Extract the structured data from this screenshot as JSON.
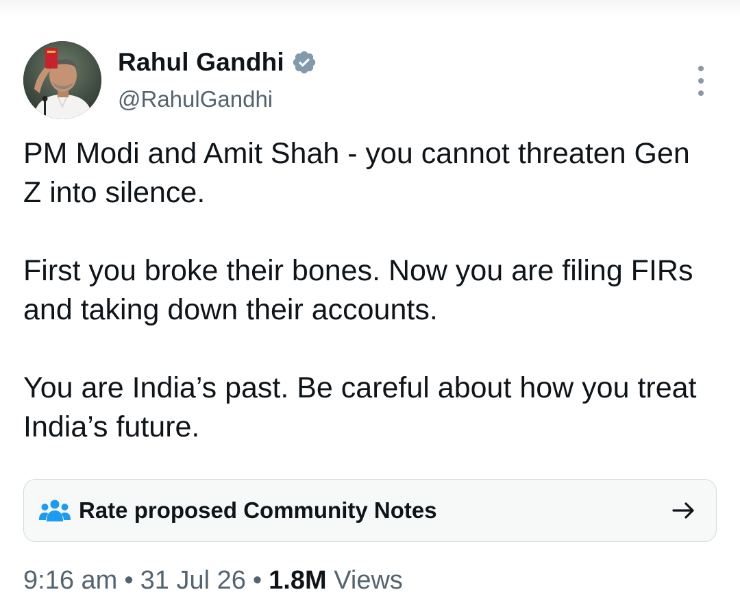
{
  "author": {
    "display_name": "Rahul Gandhi",
    "handle": "@RahulGandhi",
    "verified": true,
    "verified_icon": "verified-badge-icon"
  },
  "tweet": {
    "paragraphs": [
      "PM Modi and Amit Shah - you cannot threaten Gen Z into silence.",
      "First you broke their bones. Now you are filing FIRs and taking down their accounts.",
      "You are India’s past. Be careful about how you treat India’s future."
    ]
  },
  "community_notes": {
    "label": "Rate proposed Community Notes",
    "icon": "people-icon",
    "arrow_icon": "arrow-right-icon"
  },
  "meta": {
    "time": "9:16 am",
    "date": "31 Jul 26",
    "views_count": "1.8M",
    "views_label": "Views",
    "separator": "•"
  },
  "colors": {
    "text_primary": "#0f1419",
    "text_secondary": "#536471",
    "verified": "#829aab",
    "notes_icon": "#1d9bf0"
  }
}
